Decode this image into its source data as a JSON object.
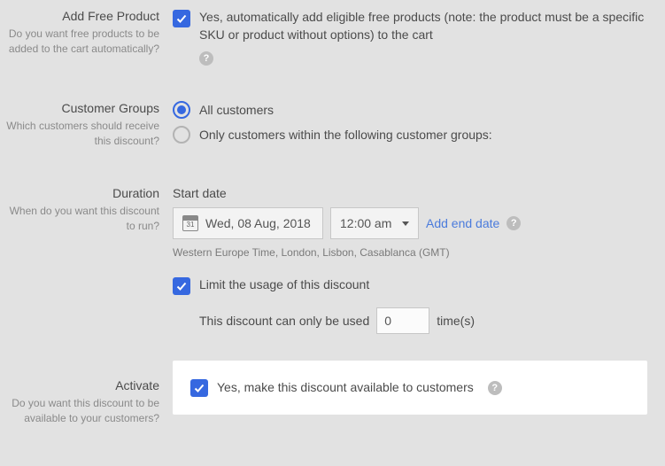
{
  "freeProduct": {
    "title": "Add Free Product",
    "sub": "Do you want free products to be added to the cart automatically?",
    "checkboxLabel": "Yes, automatically add eligible free products (note: the product must be a specific SKU or product without options) to the cart"
  },
  "customerGroups": {
    "title": "Customer Groups",
    "sub": "Which customers should receive this discount?",
    "optAll": "All customers",
    "optOnly": "Only customers within the following customer groups:"
  },
  "duration": {
    "title": "Duration",
    "sub": "When do you want this discount to run?",
    "startLabel": "Start date",
    "dateValue": "Wed, 08 Aug, 2018",
    "timeValue": "12:00 am",
    "addEnd": "Add end date",
    "tz": "Western Europe Time, London, Lisbon, Casablanca (GMT)",
    "limitLabel": "Limit the usage of this discount",
    "usagePrefix": "This discount can only be used",
    "usageValue": "0",
    "usageSuffix": "time(s)"
  },
  "activate": {
    "title": "Activate",
    "sub": "Do you want this discount to be available to your customers?",
    "checkboxLabel": "Yes, make this discount available to customers"
  },
  "helpGlyph": "?"
}
